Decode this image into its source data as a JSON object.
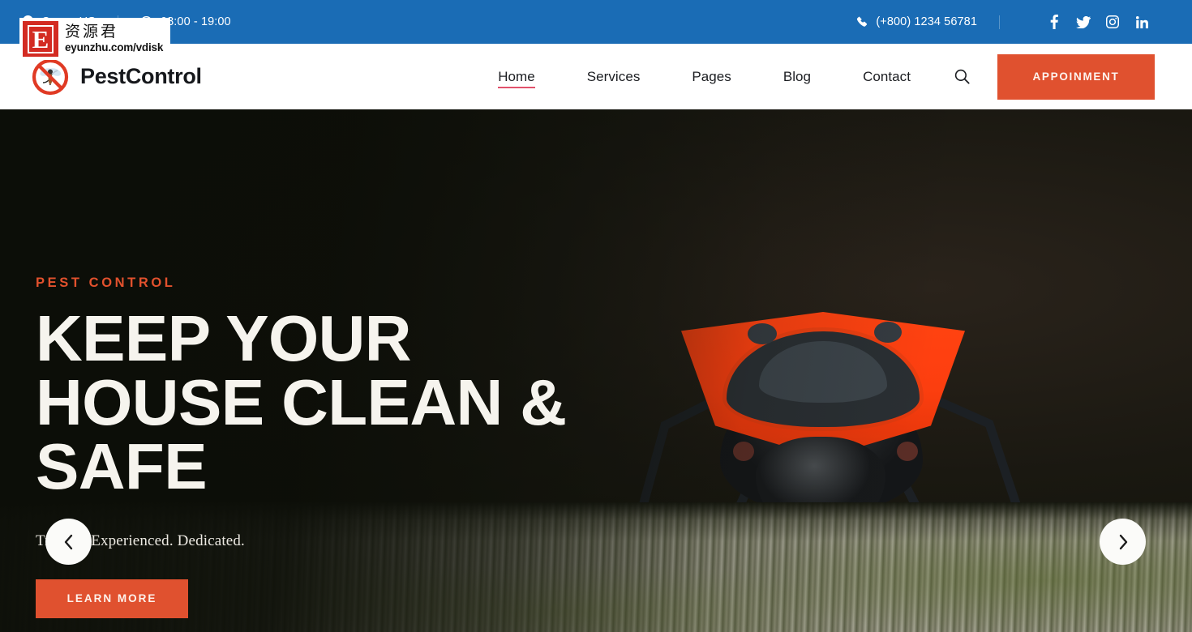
{
  "topbar": {
    "location": "Cross, US",
    "location_icon": "map-marker-icon",
    "hours": "08:00 - 19:00",
    "hours_icon": "clock-icon",
    "phone": "(+800) 1234 56781",
    "phone_icon": "phone-icon",
    "background_color": "#1a6cb5",
    "socials": [
      {
        "name": "facebook-icon",
        "label": "Facebook"
      },
      {
        "name": "twitter-icon",
        "label": "Twitter"
      },
      {
        "name": "instagram-icon",
        "label": "Instagram"
      },
      {
        "name": "linkedin-icon",
        "label": "LinkedIn"
      }
    ]
  },
  "header": {
    "brand_name": "PestControl",
    "brand_icon": "no-mosquito-icon",
    "nav": [
      {
        "label": "Home",
        "active": true
      },
      {
        "label": "Services",
        "active": false
      },
      {
        "label": "Pages",
        "active": false
      },
      {
        "label": "Blog",
        "active": false
      },
      {
        "label": "Contact",
        "active": false
      }
    ],
    "search_icon": "search-icon",
    "appointment_label": "APPOINMENT",
    "accent_color": "#e0512f",
    "active_underline_color": "#e2526c"
  },
  "hero": {
    "eyebrow": "PEST CONTROL",
    "title": "KEEP YOUR HOUSE CLEAN & SAFE",
    "subtitle": "Trusted. Experienced. Dedicated.",
    "cta_label": "LEARN MORE",
    "prev_icon": "chevron-left-icon",
    "next_icon": "chevron-right-icon",
    "eyebrow_color": "#e2512d",
    "background_description": "close-up photo of a red and black firebug on bark"
  },
  "watermark": {
    "logo_letter": "E",
    "title": "资源君",
    "url": "eyunzhu.com/vdisk"
  }
}
